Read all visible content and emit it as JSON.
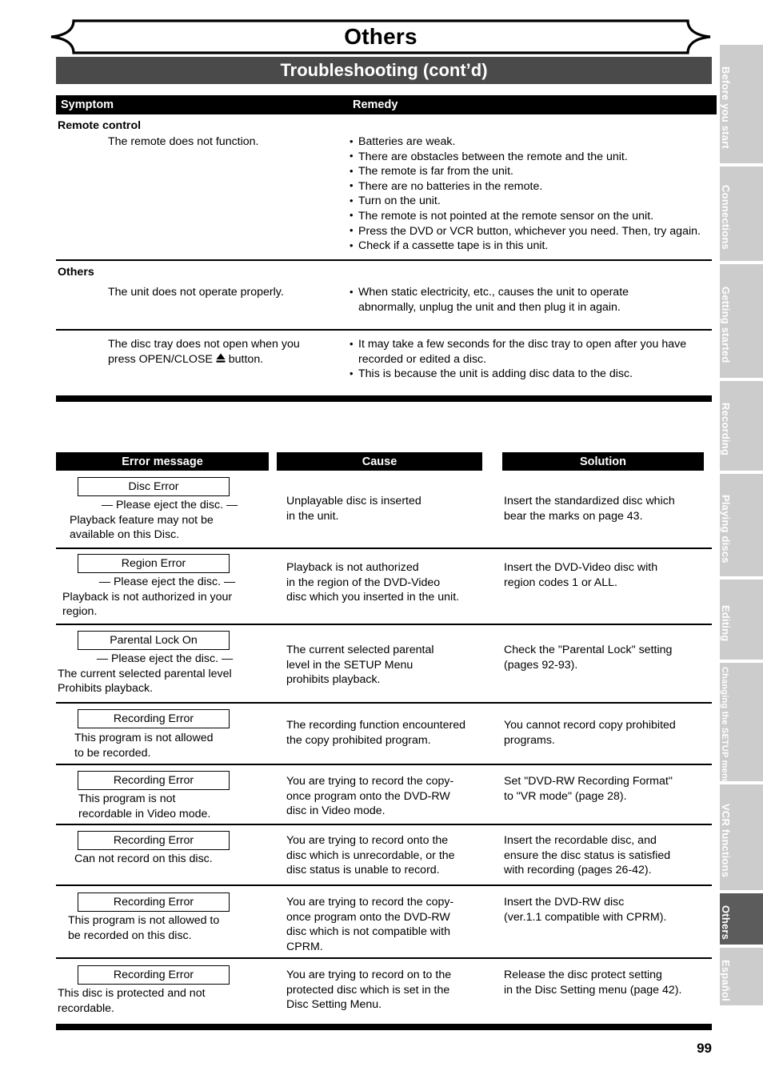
{
  "page": {
    "banner_title": "Others",
    "section_title": "Troubleshooting (cont’d)",
    "page_number": "99"
  },
  "symptom_table": {
    "headers": {
      "symptom": "Symptom",
      "remedy": "Remedy"
    },
    "groups": [
      {
        "group_label": "Remote control",
        "rows": [
          {
            "symptom": "The remote does not function.",
            "remedy": [
              "Batteries are weak.",
              "There are obstacles between the remote and the unit.",
              "The remote is far from the unit.",
              "There are no batteries in the remote.",
              "Turn on the unit.",
              "The remote is not pointed at the remote sensor on the unit.",
              "Press the DVD or VCR button, whichever you need. Then, try again.",
              "Check if a cassette tape is in this unit."
            ]
          }
        ]
      },
      {
        "group_label": "Others",
        "rows": [
          {
            "symptom": "The unit does not operate properly.",
            "remedy": [
              "When static electricity, etc., causes the unit to operate abnormally, unplug the unit and then plug it in again."
            ]
          },
          {
            "symptom_line1": "The disc tray does not open when you",
            "symptom_line2_pre": "press OPEN/CLOSE ",
            "symptom_eject_icon": "eject-symbol",
            "symptom_line2_post": " button.",
            "remedy": [
              "It may take a few seconds for the disc tray to open after you have recorded or edited a disc.",
              "This is because the unit is adding disc data to the disc."
            ]
          }
        ]
      }
    ]
  },
  "error_table": {
    "headers": {
      "error_message": "Error message",
      "cause": "Cause",
      "solution": "Solution"
    },
    "rows": [
      {
        "box_label": "Disc Error",
        "message_lines": [
          "— Please eject the disc. —",
          "Playback feature may not be",
          "available on this Disc."
        ],
        "cause_lines": [
          "Unplayable disc is inserted",
          "in the unit."
        ],
        "solution_lines": [
          "Insert the standardized disc which",
          "bear the marks on page 43."
        ]
      },
      {
        "box_label": "Region Error",
        "message_lines": [
          "— Please eject the disc. —",
          "Playback is not authorized in your",
          "region."
        ],
        "cause_lines": [
          "Playback is not authorized",
          "in the region of the DVD-Video",
          "disc which you inserted in the unit."
        ],
        "solution_lines": [
          "Insert the DVD-Video disc with",
          "region codes 1 or ALL."
        ]
      },
      {
        "box_label": "Parental Lock On",
        "message_lines": [
          "— Please eject the disc. —",
          "The current selected parental level",
          "Prohibits playback."
        ],
        "cause_lines": [
          "The current selected parental",
          "level in the SETUP Menu",
          "prohibits playback."
        ],
        "solution_lines": [
          "Check the \"Parental Lock\" setting",
          "(pages 92-93)."
        ]
      },
      {
        "box_label": "Recording Error",
        "message_lines": [
          "This program is not allowed",
          "to be recorded."
        ],
        "cause_lines": [
          "The recording function encountered",
          "the copy prohibited program."
        ],
        "solution_lines": [
          "You cannot record copy prohibited",
          "programs."
        ]
      },
      {
        "box_label": "Recording Error",
        "message_lines": [
          "This program is not",
          "recordable in Video mode."
        ],
        "cause_lines": [
          "You are trying to record the copy-",
          "once program onto the DVD-RW",
          "disc in Video mode."
        ],
        "solution_lines": [
          "Set \"DVD-RW Recording Format\"",
          "to \"VR mode\" (page 28)."
        ]
      },
      {
        "box_label": "Recording Error",
        "message_lines": [
          "Can not record on this disc."
        ],
        "cause_lines": [
          "You are trying to record onto the",
          "disc which is unrecordable, or the",
          "disc status is unable to record."
        ],
        "solution_lines": [
          "Insert the recordable disc, and",
          "ensure the disc status is satisfied",
          "with recording (pages 26-42)."
        ]
      },
      {
        "box_label": "Recording Error",
        "message_lines": [
          "This program is not allowed to",
          "be recorded on this disc."
        ],
        "cause_lines": [
          "You are trying to record the copy-",
          "once program onto the DVD-RW",
          "disc which is not compatible with",
          "CPRM."
        ],
        "solution_lines": [
          "Insert the DVD-RW disc",
          "(ver.1.1 compatible with CPRM)."
        ]
      },
      {
        "box_label": "Recording Error",
        "message_lines": [
          "This disc is protected and not",
          "recordable."
        ],
        "cause_lines": [
          "You are trying to record on to the",
          "protected disc which is set in the",
          "Disc Setting Menu."
        ],
        "solution_lines": [
          "Release the disc protect setting",
          "in the Disc Setting menu (page 42)."
        ]
      }
    ]
  },
  "side_tabs": {
    "items": [
      {
        "label": "Before you start",
        "active": false
      },
      {
        "label": "Connections",
        "active": false
      },
      {
        "label": "Getting started",
        "active": false
      },
      {
        "label": "Recording",
        "active": false
      },
      {
        "label": "Playing discs",
        "active": false
      },
      {
        "label": "Editing",
        "active": false
      },
      {
        "label": "Changing the SETUP menu",
        "active": false
      },
      {
        "label": "VCR functions",
        "active": false
      },
      {
        "label": "Others",
        "active": true
      },
      {
        "label": "Español",
        "active": false
      }
    ]
  },
  "colors": {
    "band_gray": "#4a4a4a",
    "tab_inactive": "#cccccc",
    "tab_active": "#5c5c5c",
    "rule_black": "#000000"
  }
}
